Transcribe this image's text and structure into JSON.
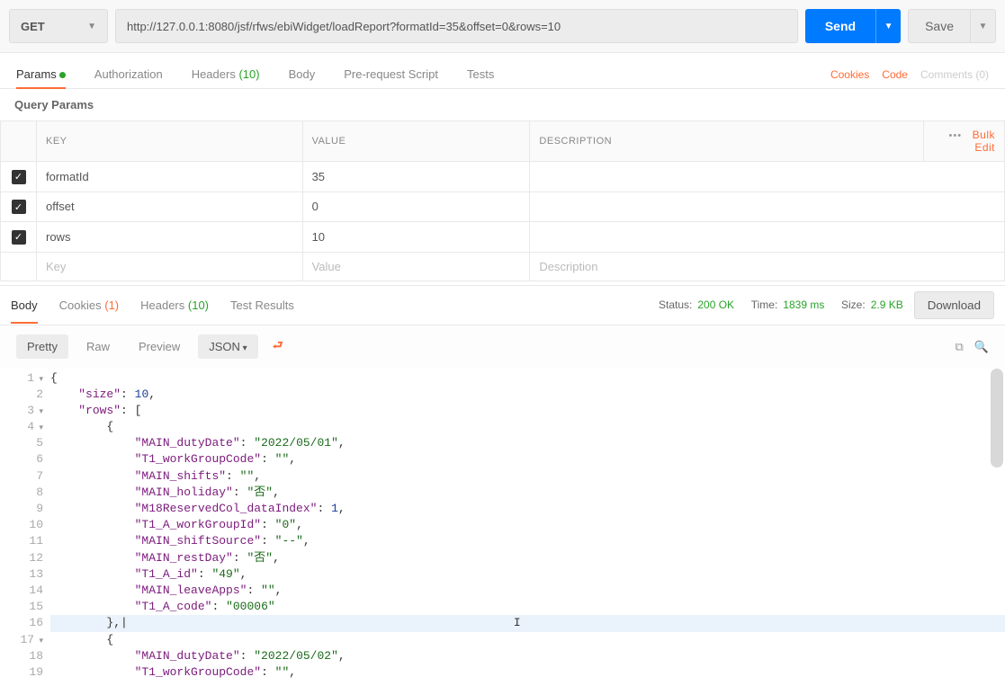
{
  "request": {
    "method": "GET",
    "url": "http://127.0.0.1:8080/jsf/rfws/ebiWidget/loadReport?formatId=35&offset=0&rows=10",
    "send_label": "Send",
    "save_label": "Save"
  },
  "req_tabs": {
    "params": "Params",
    "authorization": "Authorization",
    "headers": "Headers",
    "headers_count": "(10)",
    "body": "Body",
    "prerequest": "Pre-request Script",
    "tests": "Tests"
  },
  "links": {
    "cookies": "Cookies",
    "code": "Code",
    "comments": "Comments (0)"
  },
  "query_params": {
    "title": "Query Params",
    "col_key": "KEY",
    "col_value": "VALUE",
    "col_desc": "DESCRIPTION",
    "bulk": "Bulk Edit",
    "rows": [
      {
        "key": "formatId",
        "value": "35",
        "desc": ""
      },
      {
        "key": "offset",
        "value": "0",
        "desc": ""
      },
      {
        "key": "rows",
        "value": "10",
        "desc": ""
      }
    ],
    "ph_key": "Key",
    "ph_value": "Value",
    "ph_desc": "Description"
  },
  "resp_tabs": {
    "body": "Body",
    "cookies": "Cookies",
    "cookies_count": "(1)",
    "headers": "Headers",
    "headers_count": "(10)",
    "tests": "Test Results"
  },
  "status": {
    "status_label": "Status:",
    "status_value": "200 OK",
    "time_label": "Time:",
    "time_value": "1839 ms",
    "size_label": "Size:",
    "size_value": "2.9 KB",
    "download": "Download"
  },
  "viewbar": {
    "pretty": "Pretty",
    "raw": "Raw",
    "preview": "Preview",
    "format": "JSON"
  },
  "code": {
    "lines": [
      {
        "n": "1",
        "fold": true
      },
      {
        "n": "2"
      },
      {
        "n": "3",
        "fold": true
      },
      {
        "n": "4",
        "fold": true
      },
      {
        "n": "5"
      },
      {
        "n": "6"
      },
      {
        "n": "7"
      },
      {
        "n": "8"
      },
      {
        "n": "9"
      },
      {
        "n": "10"
      },
      {
        "n": "11"
      },
      {
        "n": "12"
      },
      {
        "n": "13"
      },
      {
        "n": "14"
      },
      {
        "n": "15"
      },
      {
        "n": "16"
      },
      {
        "n": "17",
        "fold": true
      },
      {
        "n": "18"
      },
      {
        "n": "19"
      }
    ],
    "body": {
      "size_key": "\"size\"",
      "size_val": "10",
      "rows_key": "\"rows\"",
      "p": {
        "dutyDate": "\"MAIN_dutyDate\"",
        "dutyDate_v": "\"2022/05/01\"",
        "wg": "\"T1_workGroupCode\"",
        "wg_v": "\"\"",
        "shifts": "\"MAIN_shifts\"",
        "shifts_v": "\"\"",
        "holiday": "\"MAIN_holiday\"",
        "holiday_v": "\"否\"",
        "reserved": "\"M18ReservedCol_dataIndex\"",
        "reserved_v": "1",
        "wgid": "\"T1_A_workGroupId\"",
        "wgid_v": "\"0\"",
        "ss": "\"MAIN_shiftSource\"",
        "ss_v": "\"--\"",
        "rest": "\"MAIN_restDay\"",
        "rest_v": "\"否\"",
        "aid": "\"T1_A_id\"",
        "aid_v": "\"49\"",
        "leave": "\"MAIN_leaveApps\"",
        "leave_v": "\"\"",
        "acode": "\"T1_A_code\"",
        "acode_v": "\"00006\"",
        "dutyDate2_v": "\"2022/05/02\""
      }
    }
  }
}
